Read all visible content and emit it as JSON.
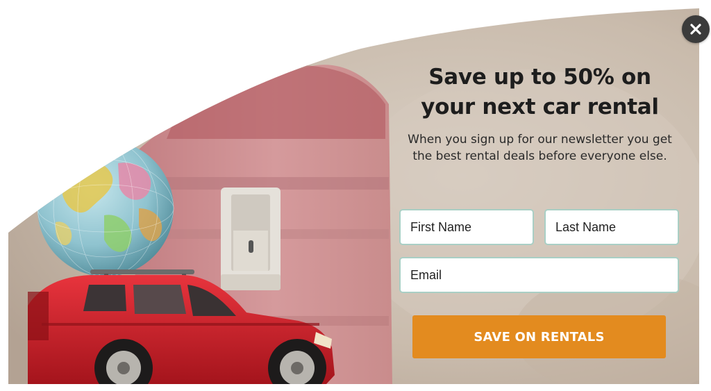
{
  "popup": {
    "headline": "Save up to 50% on your next car rental",
    "subtext": "When you sign up for our newsletter you get the best rental deals before everyone else.",
    "form": {
      "first_name_placeholder": "First Name",
      "last_name_placeholder": "Last Name",
      "email_placeholder": "Email",
      "submit_label": "SAVE ON RENTALS"
    },
    "close_icon": "close-icon"
  },
  "colors": {
    "submit_button": "#e38b1f",
    "field_border": "#a9cfc5",
    "headline_text": "#1d1d1d",
    "close_button": "#3b3b3b"
  }
}
